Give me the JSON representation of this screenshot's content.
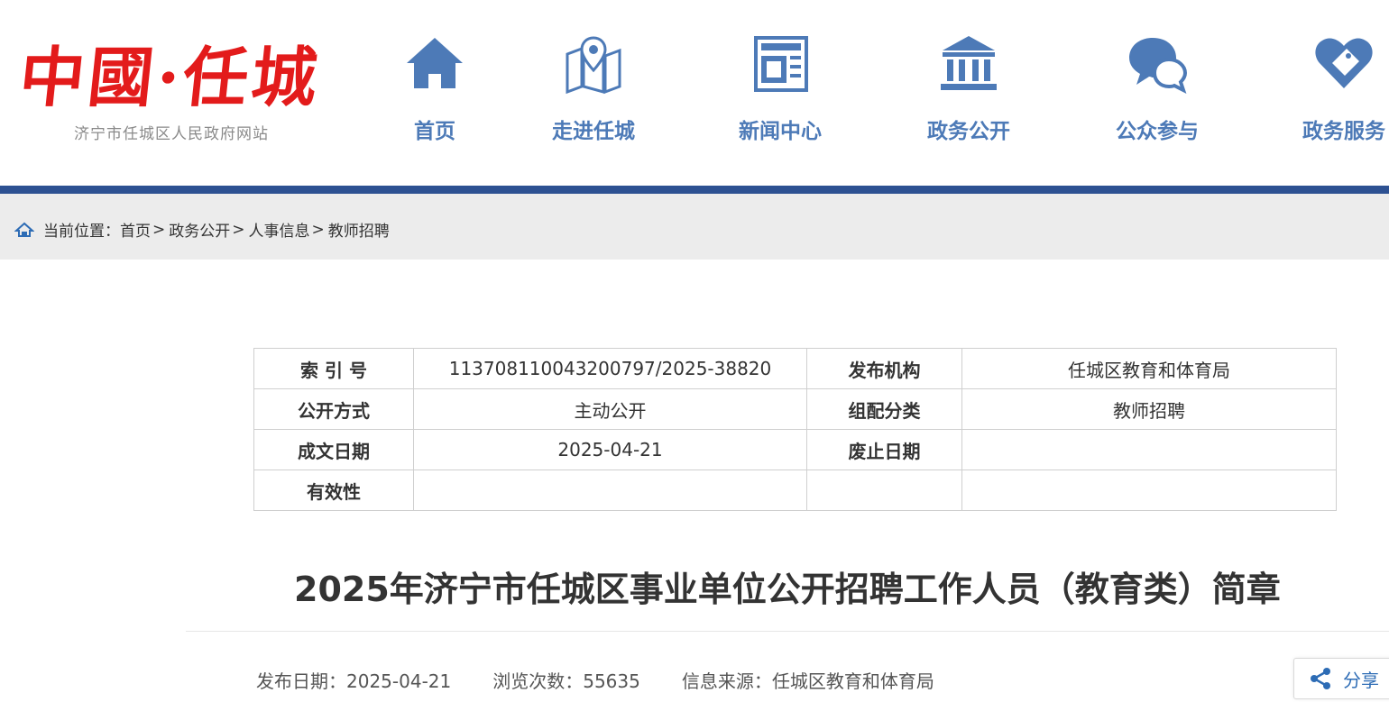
{
  "header": {
    "logo_text": "中國·任城",
    "logo_subtitle": "济宁市任城区人民政府网站",
    "nav": [
      {
        "label": "首页",
        "icon": "home-icon"
      },
      {
        "label": "走进任城",
        "icon": "map-pin-icon"
      },
      {
        "label": "新闻中心",
        "icon": "news-icon"
      },
      {
        "label": "政务公开",
        "icon": "government-building-icon"
      },
      {
        "label": "公众参与",
        "icon": "chat-bubbles-icon"
      },
      {
        "label": "政务服务",
        "icon": "service-heart-icon"
      }
    ],
    "nav_color": "#4d7ab7",
    "bar_color": "#2d5192"
  },
  "breadcrumb": {
    "prefix": "当前位置：",
    "items": [
      "首页",
      "政务公开",
      "人事信息",
      "教师招聘"
    ],
    "separator": ">"
  },
  "info_table": {
    "index_label": "索 引 号",
    "index_value": "11370811004320079​7/2025-38820",
    "publisher_label": "发布机构",
    "publisher_value": "任城区教育和体育局",
    "disclosure_label": "公开方式",
    "disclosure_value": "主动公开",
    "category_label": "组配分类",
    "category_value": "教师招聘",
    "date_label": "成文日期",
    "date_value": "2025-04-21",
    "abolish_label": "废止日期",
    "abolish_value": "",
    "validity_label": "有效性",
    "validity_value": ""
  },
  "article": {
    "title": "2025年济宁市任城区事业单位公开招聘工作人员（教育类）简章",
    "publish_date": "发布日期：2025-04-21",
    "views": "浏览次数：55635",
    "source": "信息来源：任城区教育和体育局"
  },
  "share": {
    "label": "分享",
    "icon": "share-icon"
  }
}
